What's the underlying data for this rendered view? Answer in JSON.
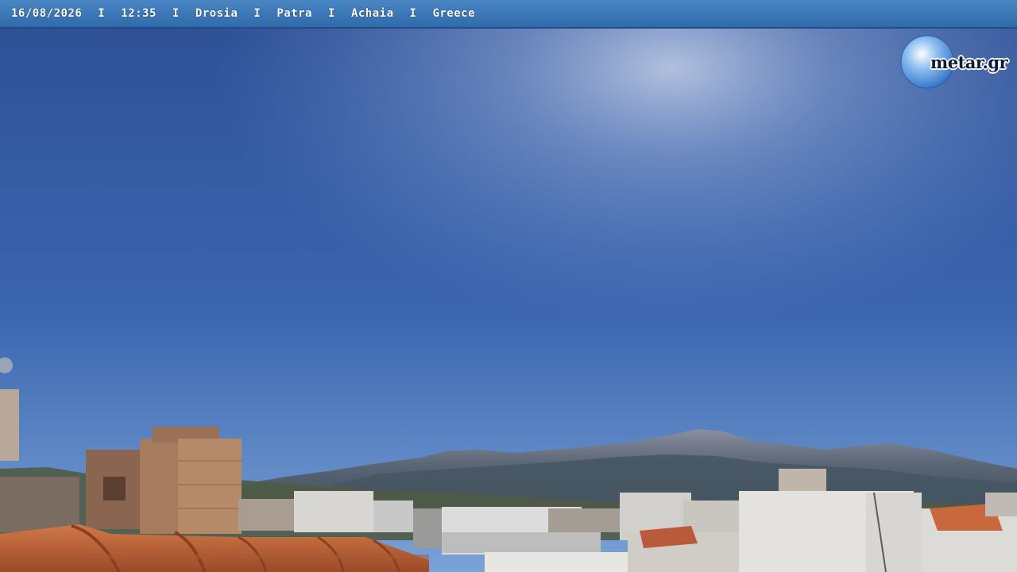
{
  "overlay": {
    "date": "16/08/2026",
    "time": "12:35",
    "place": "Drosia",
    "city": "Patra",
    "region": "Achaia",
    "country": "Greece",
    "separator": "I"
  },
  "logo": {
    "text": "metar.gr"
  },
  "colors": {
    "sky_top": "#2a4f96",
    "sky_bottom": "#6f9bd2",
    "bar": "#3b78b9",
    "mountains": "#4e5e72",
    "roof_tile": "#c9683c"
  }
}
